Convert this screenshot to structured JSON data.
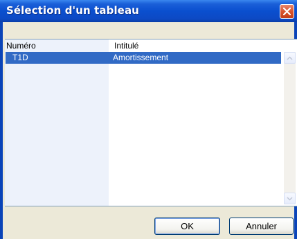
{
  "window": {
    "title": "Sélection d'un tableau"
  },
  "table": {
    "columns": [
      "Numéro",
      "Intitulé"
    ],
    "rows": [
      {
        "numero": "T1D",
        "intitule": "Amortissement",
        "selected": true
      }
    ]
  },
  "buttons": {
    "ok": "OK",
    "cancel": "Annuler"
  },
  "icons": {
    "close": "close-icon",
    "scroll_up": "arrow-up-icon",
    "scroll_down": "arrow-down-icon"
  },
  "colors": {
    "title_bar": "#0a4fcf",
    "selection": "#316ac5",
    "dialog_bg": "#ece9d8",
    "close_button": "#d8542f"
  }
}
